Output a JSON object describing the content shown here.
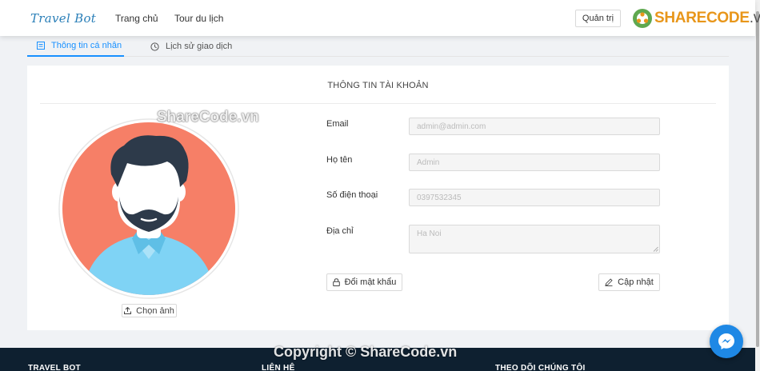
{
  "header": {
    "logo": "Travel Bot",
    "nav": [
      "Trang chủ",
      "Tour du lịch"
    ],
    "admin_button": "Quản trị"
  },
  "brand": {
    "name": "SHARECODE",
    "suffix": ".vn"
  },
  "tabs": [
    {
      "label": "Thông tin cá nhân",
      "icon": "profile-icon",
      "active": true
    },
    {
      "label": "Lịch sử giao dịch",
      "icon": "history-icon",
      "active": false
    }
  ],
  "card": {
    "title": "THÔNG TIN TÀI KHOẢN",
    "upload_button": "Chọn ảnh",
    "fields": {
      "email": {
        "label": "Email",
        "value": "admin@admin.com"
      },
      "name": {
        "label": "Họ tên",
        "value": "Admin"
      },
      "phone": {
        "label": "Số điện thoại",
        "value": "0397532345"
      },
      "address": {
        "label": "Địa chỉ",
        "value": "Ha Noi"
      }
    },
    "change_password_button": "Đổi mật khẩu",
    "update_button": "Cập nhật"
  },
  "footer": {
    "columns": [
      "TRAVEL BOT",
      "LIÊN HỆ",
      "THEO DÕI CHÚNG TÔI"
    ]
  },
  "watermarks": {
    "top": "ShareCode.vn",
    "bottom": "Copyright © ShareCode.vn"
  },
  "colors": {
    "accent": "#1890ff",
    "avatar_bg": "#f67f67",
    "footer_bg": "#0e2030",
    "messenger": "#1e88e5"
  }
}
